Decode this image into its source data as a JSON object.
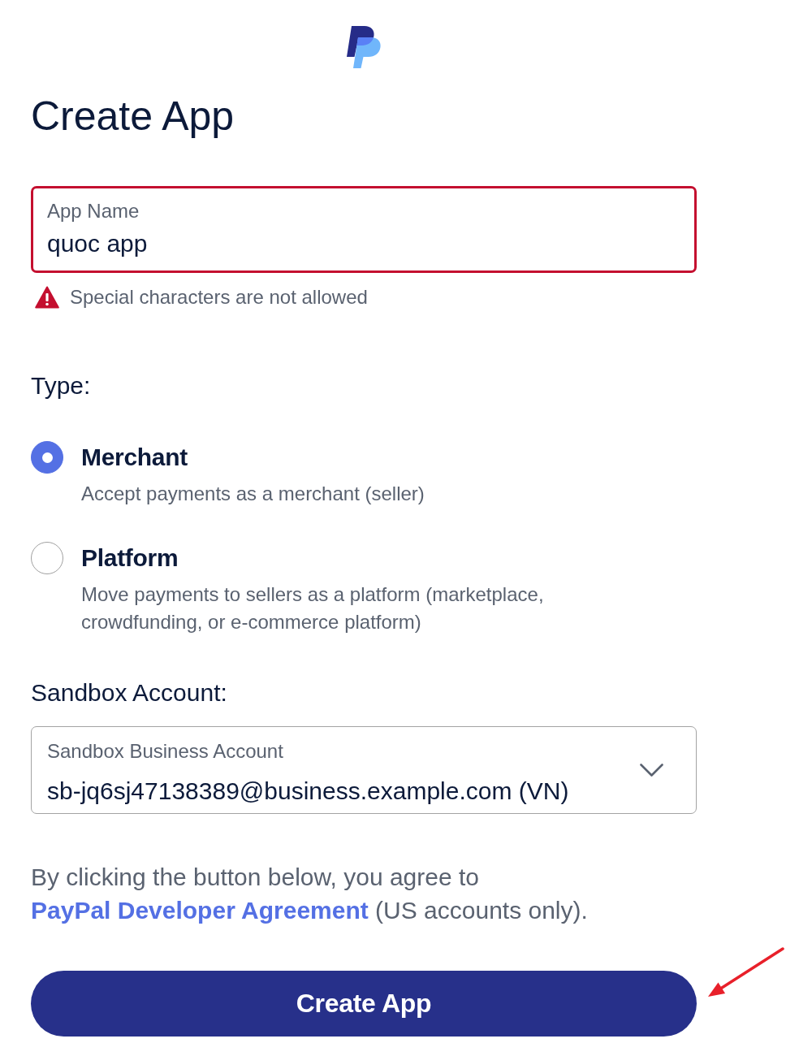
{
  "page": {
    "title": "Create App"
  },
  "app_name_field": {
    "label": "App Name",
    "value": "quoc app",
    "invalid": true,
    "error": "Special characters are not allowed"
  },
  "type_section": {
    "heading": "Type:",
    "options": [
      {
        "label": "Merchant",
        "description": "Accept payments as a merchant (seller)",
        "selected": true
      },
      {
        "label": "Platform",
        "description": "Move payments to sellers as a platform (marketplace, crowdfunding, or e-commerce platform)",
        "selected": false
      }
    ]
  },
  "sandbox_section": {
    "heading": "Sandbox Account:",
    "select": {
      "label": "Sandbox Business Account",
      "value": "sb-jq6sj47138389@business.example.com (VN)"
    }
  },
  "agreement": {
    "text_before": "By clicking the button below, you agree to",
    "link": "PayPal Developer Agreement",
    "text_after": "(US accounts only)."
  },
  "submit_button": {
    "label": "Create App"
  }
}
